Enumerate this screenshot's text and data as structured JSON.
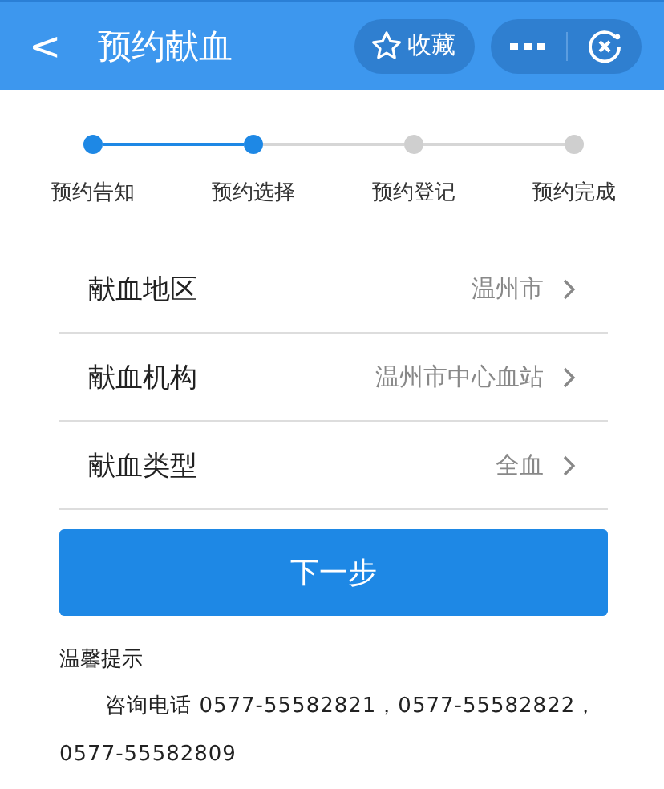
{
  "header": {
    "back": "<",
    "title": "预约献血",
    "favorite": "收藏"
  },
  "steps": [
    {
      "label": "预约告知",
      "done": true
    },
    {
      "label": "预约选择",
      "done": true
    },
    {
      "label": "预约登记",
      "done": false
    },
    {
      "label": "预约完成",
      "done": false
    }
  ],
  "fields": [
    {
      "label": "献血地区",
      "value": "温州市"
    },
    {
      "label": "献血机构",
      "value": "温州市中心血站"
    },
    {
      "label": "献血类型",
      "value": "全血"
    }
  ],
  "next_button": "下一步",
  "tip": {
    "title": "温馨提示",
    "text": "咨询电话 0577-55582821，0577-55582822，0577-55582809"
  }
}
